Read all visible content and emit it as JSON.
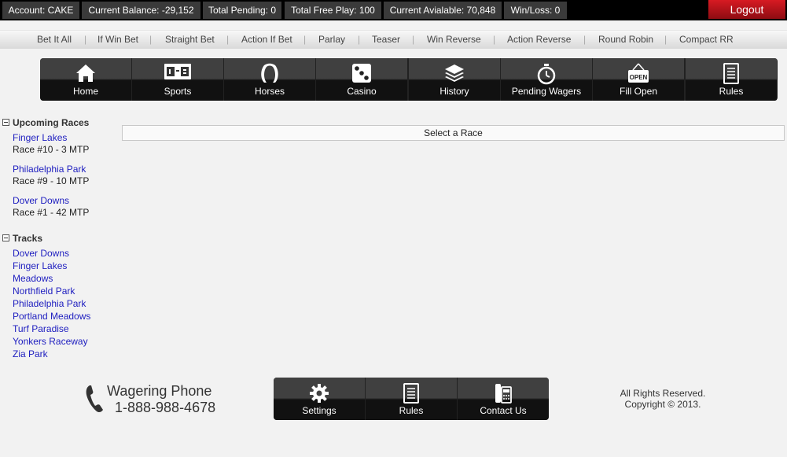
{
  "topbar": {
    "account": "Account: CAKE",
    "balance": "Current Balance: -29,152",
    "pending": "Total Pending: 0",
    "freeplay": "Total Free Play: 100",
    "available": "Current Avialable: 70,848",
    "winloss": "Win/Loss: 0",
    "logout": "Logout",
    "logout_color": "#c8121a"
  },
  "betmenu": [
    "Bet It All",
    "If Win Bet",
    "Straight Bet",
    "Action If Bet",
    "Parlay",
    "Teaser",
    "Win Reverse",
    "Action Reverse",
    "Round Robin",
    "Compact RR"
  ],
  "nav": [
    {
      "label": "Home",
      "icon": "home-icon"
    },
    {
      "label": "Sports",
      "icon": "scoreboard-icon"
    },
    {
      "label": "Horses",
      "icon": "horseshoe-icon"
    },
    {
      "label": "Casino",
      "icon": "dice-icon"
    },
    {
      "label": "History",
      "icon": "layers-icon"
    },
    {
      "label": "Pending Wagers",
      "icon": "stopwatch-icon"
    },
    {
      "label": "Fill Open",
      "icon": "open-sign-icon",
      "sign_text": "OPEN"
    },
    {
      "label": "Rules",
      "icon": "document-icon"
    }
  ],
  "sidebar": {
    "upcoming_title": "Upcoming Races",
    "upcoming": [
      {
        "track": "Finger Lakes",
        "race": "Race #10 - 3 MTP"
      },
      {
        "track": "Philadelphia Park",
        "race": "Race #9 - 10 MTP"
      },
      {
        "track": "Dover Downs",
        "race": "Race #1 - 42 MTP"
      }
    ],
    "tracks_title": "Tracks",
    "tracks": [
      "Dover Downs",
      "Finger Lakes",
      "Meadows",
      "Northfield Park",
      "Philadelphia Park",
      "Portland Meadows",
      "Turf Paradise",
      "Yonkers Raceway",
      "Zia Park"
    ]
  },
  "main": {
    "select_race": "Select a Race"
  },
  "footer": {
    "phone_title": "Wagering Phone",
    "phone_number": "1-888-988-4678",
    "nav": [
      {
        "label": "Settings",
        "icon": "gear-icon"
      },
      {
        "label": "Rules",
        "icon": "document-icon"
      },
      {
        "label": "Contact Us",
        "icon": "telephone-icon"
      }
    ],
    "copy1": "All Rights Reserved.",
    "copy2": "Copyright © 2013."
  }
}
